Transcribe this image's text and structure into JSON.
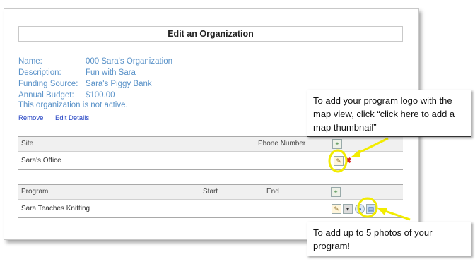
{
  "window": {
    "title": "Edit an Organization"
  },
  "organization": {
    "name_label": "Name:",
    "name_value": "000 Sara's Organization",
    "description_label": "Description:",
    "description_value": "Fun with Sara",
    "funding_label": "Funding Source:",
    "funding_value": "Sara's Piggy Bank",
    "budget_label": "Annual Budget:",
    "budget_value": "$100.00",
    "status_text": "This organization is not active."
  },
  "links": {
    "remove": "Remove",
    "edit_details": "Edit Details"
  },
  "sites_table": {
    "headers": {
      "site": "Site",
      "phone": "Phone Number"
    },
    "rows": [
      {
        "site": "Sara's Office",
        "phone": ""
      }
    ]
  },
  "programs_table": {
    "headers": {
      "program": "Program",
      "start": "Start",
      "end": "End"
    },
    "rows": [
      {
        "program": "Sara Teaches Knitting",
        "start": "",
        "end": ""
      }
    ]
  },
  "callouts": {
    "logo": "To add your program logo with the map view, click “click here to add a map thumbnail”",
    "photos": "To add up to 5 photos of your program!"
  },
  "colors": {
    "highlight": "#f2ec00",
    "link": "#1f3fc2",
    "info_text": "#5b93c9"
  },
  "icons": [
    "edit-icon",
    "delete-icon",
    "add-icon",
    "dropdown-icon",
    "globe-icon",
    "map-thumbnail-icon"
  ]
}
